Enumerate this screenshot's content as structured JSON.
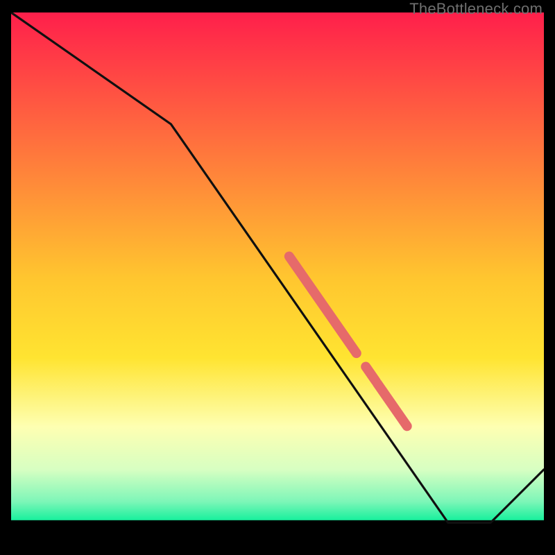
{
  "watermark": "TheBottleneck.com",
  "colors": {
    "top": "#ff1f4b",
    "yellow": "#ffe431",
    "pale_yellow": "#feffb8",
    "green": "#19f09d",
    "black": "#000000",
    "curve": "#101010",
    "marker": "#e66a6a",
    "watermark": "#6f6f6f"
  },
  "chart_data": {
    "type": "line",
    "title": "",
    "xlabel": "",
    "ylabel": "",
    "xlim": [
      0,
      100
    ],
    "ylim": [
      0,
      100
    ],
    "x": [
      0,
      30,
      82,
      90,
      100
    ],
    "y": [
      100,
      79,
      4,
      4,
      14
    ],
    "series": [
      {
        "name": "bottleneck-curve",
        "x": [
          0,
          30,
          82,
          90,
          100
        ],
        "y": [
          100,
          79,
          4,
          4,
          14
        ]
      }
    ],
    "markers": {
      "name": "highlighted-segment",
      "style": "thick-dashed",
      "color": "#e66a6a",
      "points": [
        {
          "x": 58.5,
          "y": 45.0,
          "len": 13.5
        },
        {
          "x": 67.5,
          "y": 32.0,
          "len": 2.0
        },
        {
          "x": 71.5,
          "y": 26.2,
          "len": 6.0
        }
      ]
    },
    "gradient_stops": [
      {
        "offset": 0.0,
        "color": "#ff1f4b"
      },
      {
        "offset": 0.5,
        "color": "#ffc62f"
      },
      {
        "offset": 0.65,
        "color": "#ffe431"
      },
      {
        "offset": 0.78,
        "color": "#feffb2"
      },
      {
        "offset": 0.86,
        "color": "#d7ffc2"
      },
      {
        "offset": 0.92,
        "color": "#7ef6b8"
      },
      {
        "offset": 0.955,
        "color": "#19f09d"
      },
      {
        "offset": 0.956,
        "color": "#000000"
      },
      {
        "offset": 1.0,
        "color": "#000000"
      }
    ]
  }
}
